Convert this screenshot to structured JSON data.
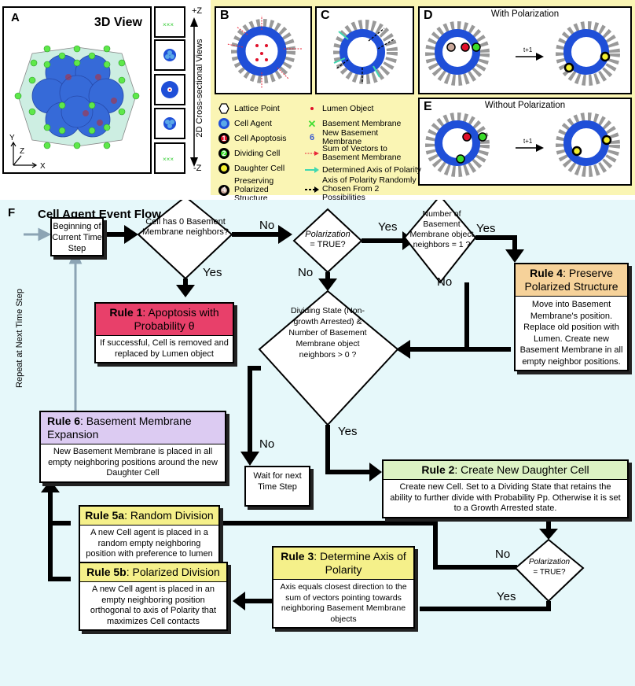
{
  "panelA": {
    "label": "A",
    "title": "3D View",
    "axes": {
      "y": "Y",
      "z": "Z",
      "x": "X"
    },
    "cross_section_axis": {
      "top": "+Z",
      "bottom": "-Z",
      "label": "2D Cross-sectional Views"
    }
  },
  "panelB": {
    "label": "B"
  },
  "panelC": {
    "label": "C"
  },
  "panelD": {
    "label": "D",
    "title": "With Polarization",
    "step": "t+1"
  },
  "panelE": {
    "label": "E",
    "title": "Without Polarization",
    "step": "t+1"
  },
  "legend": {
    "left": [
      {
        "icon": "lattice-point-icon",
        "label": "Lattice Point"
      },
      {
        "icon": "cell-agent-icon",
        "label": "Cell Agent"
      },
      {
        "icon": "cell-apoptosis-icon",
        "label": "Cell Apoptosis",
        "glyph": "1"
      },
      {
        "icon": "dividing-cell-icon",
        "label": "Dividing Cell",
        "glyph": "2"
      },
      {
        "icon": "daughter-cell-icon",
        "label": "Daughter Cell"
      },
      {
        "icon": "preserving-structure-icon",
        "label": "Preserving Polarized Structure",
        "glyph": "4"
      }
    ],
    "right": [
      {
        "icon": "lumen-object-icon",
        "label": "Lumen Object"
      },
      {
        "icon": "basement-membrane-icon",
        "label": "Basement Membrane"
      },
      {
        "icon": "new-basement-membrane-icon",
        "label": "New Basement Membrane",
        "glyph": "6"
      },
      {
        "icon": "sum-vectors-arrow-icon",
        "label": "Sum of Vectors to Basement Membrane"
      },
      {
        "icon": "axis-polarity-arrow-icon",
        "label": "Determined Axis of Polarity"
      },
      {
        "icon": "random-axis-arrow-icon",
        "label": "Axis of Polarity Randomly Chosen From 2 Possibilities"
      }
    ],
    "colors": {
      "cell_agent": "#1f4fd8",
      "cell_inner": "#5aa8e8",
      "apoptosis": "#e0102a",
      "dividing": "#3adb2a",
      "daughter": "#f2ee30",
      "preserving": "#c9a79a",
      "lumen": "#e0102a",
      "membrane": "#44dd33",
      "new_membrane": "#3a5bd0",
      "sum_vector": "#e8283a",
      "axis_polarity": "#40d8b0"
    }
  },
  "flow": {
    "label": "F",
    "title": "Cell Agent Event Flow Chart",
    "start": "Beginning of Current Time Step",
    "repeat": "Repeat at Next Time Step",
    "q1": "Cell has 0 Basement Membrane neighbors?",
    "q2_italic": "Polarization",
    "q2_rest": "= TRUE?",
    "q3": "Number of Basement Membrane object neighbors = 1 ?",
    "q4": "Dividing State (Non-growth Arrested) & Number of Basement Membrane object neighbors > 0 ?",
    "q5_italic": "Polarization",
    "q5_rest": "= TRUE?",
    "wait": "Wait for next Time Step",
    "labels": {
      "yes": "Yes",
      "no": "No"
    },
    "rules": {
      "r1": {
        "bold": "Rule 1",
        "title": ": Apoptosis with Probability θ",
        "body": "If successful, Cell is removed and replaced by Lumen object",
        "color": "#e8406a"
      },
      "r2": {
        "bold": "Rule 2",
        "title": ": Create New Daughter Cell",
        "body": "Create new Cell. Set to a Dividing State that retains the ability to further divide with Probability Pp. Otherwise it is set to a Growth Arrested state.",
        "color": "#dcf2c4"
      },
      "r3": {
        "bold": "Rule 3",
        "title": ": Determine Axis of Polarity",
        "body": "Axis equals closest direction to the sum of vectors pointing towards neighboring Basement Membrane objects",
        "color": "#f5f08a"
      },
      "r4": {
        "bold": "Rule 4",
        "title": ": Preserve Polarized Structure",
        "body": "Move into Basement Membrane's position. Replace old position with Lumen. Create new Basement Membrane in all empty neighbor positions.",
        "color": "#f6d29a"
      },
      "r5a": {
        "bold": "Rule 5a",
        "title": ": Random Division",
        "body": "A new Cell agent is placed in a random empty neighboring position with preference to lumen",
        "color": "#f5f08a"
      },
      "r5b": {
        "bold": "Rule 5b",
        "title": ": Polarized Division",
        "body": "A new Cell agent is placed in an empty neighboring position orthogonal to axis of Polarity that maximizes Cell contacts",
        "color": "#f5f08a"
      },
      "r6": {
        "bold": "Rule 6",
        "title": ": Basement Membrane Expansion",
        "body": "New Basement Membrane is placed in all empty neighboring positions around the new Daughter Cell",
        "color": "#dccbf2"
      }
    }
  }
}
